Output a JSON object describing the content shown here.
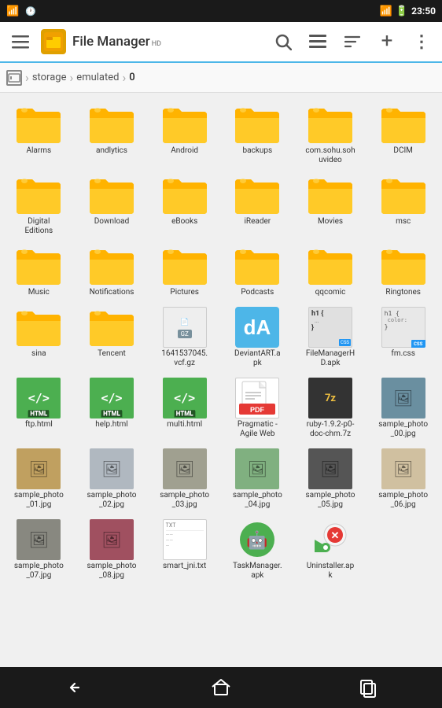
{
  "statusBar": {
    "time": "23:50",
    "batteryLevel": "80"
  },
  "toolbar": {
    "menuIcon": "☰",
    "title": "File Manager",
    "titleSup": "HD",
    "searchIcon": "search",
    "listViewIcon": "list",
    "sortIcon": "sort",
    "addIcon": "+",
    "moreIcon": "⋮"
  },
  "breadcrumb": {
    "storageLabel": "storage",
    "emulatedLabel": "emulated",
    "currentLabel": "0"
  },
  "files": [
    {
      "name": "Alarms",
      "type": "folder",
      "id": "alarms"
    },
    {
      "name": "andlytics",
      "type": "folder",
      "id": "andlytics"
    },
    {
      "name": "Android",
      "type": "folder",
      "id": "android"
    },
    {
      "name": "backups",
      "type": "folder",
      "id": "backups"
    },
    {
      "name": "com.sohu.soh\nuvideo",
      "type": "folder",
      "id": "sohu"
    },
    {
      "name": "DCIM",
      "type": "folder",
      "id": "dcim"
    },
    {
      "name": "Digital\nEditions",
      "type": "folder",
      "id": "digital"
    },
    {
      "name": "Download",
      "type": "folder",
      "id": "download"
    },
    {
      "name": "eBooks",
      "type": "folder",
      "id": "ebooks"
    },
    {
      "name": "iReader",
      "type": "folder",
      "id": "ireader"
    },
    {
      "name": "Movies",
      "type": "folder",
      "id": "movies"
    },
    {
      "name": "msc",
      "type": "folder",
      "id": "msc"
    },
    {
      "name": "Music",
      "type": "folder",
      "id": "music"
    },
    {
      "name": "Notifications",
      "type": "folder",
      "id": "notifications"
    },
    {
      "name": "Pictures",
      "type": "folder",
      "id": "pictures"
    },
    {
      "name": "Podcasts",
      "type": "folder",
      "id": "podcasts"
    },
    {
      "name": "qqcomic",
      "type": "folder",
      "id": "qqcomic"
    },
    {
      "name": "Ringtones",
      "type": "folder",
      "id": "ringtones"
    },
    {
      "name": "sina",
      "type": "folder",
      "id": "sina"
    },
    {
      "name": "Tencent",
      "type": "folder",
      "id": "tencent"
    },
    {
      "name": "1641537045.\nvcf.gz",
      "type": "gz",
      "id": "vcfgz"
    },
    {
      "name": "DeviantART.a\npk",
      "type": "apk-deviant",
      "id": "deviantart"
    },
    {
      "name": "FileManagerH\nD.apk",
      "type": "apk-fm",
      "id": "fmapk"
    },
    {
      "name": "fm.css",
      "type": "css",
      "id": "fmcss"
    },
    {
      "name": "ftp.html",
      "type": "html",
      "id": "ftphtml"
    },
    {
      "name": "help.html",
      "type": "html",
      "id": "helphtml"
    },
    {
      "name": "multi.html",
      "type": "html",
      "id": "multihtml"
    },
    {
      "name": "Pragmatic -\nAgile Web",
      "type": "pdf",
      "id": "pdf1"
    },
    {
      "name": "ruby-1.9.2-p0-\ndoc-chm.7z",
      "type": "7z",
      "id": "ruby7z"
    },
    {
      "name": "sample_photo\n_00.jpg",
      "type": "photo",
      "color": "#6a8fa0",
      "id": "photo00"
    },
    {
      "name": "sample_photo\n_01.jpg",
      "type": "photo",
      "color": "#c0a060",
      "id": "photo01"
    },
    {
      "name": "sample_photo\n_02.jpg",
      "type": "photo",
      "color": "#b0b8c0",
      "id": "photo02"
    },
    {
      "name": "sample_photo\n_03.jpg",
      "type": "photo",
      "color": "#a0a090",
      "id": "photo03"
    },
    {
      "name": "sample_photo\n_04.jpg",
      "type": "photo",
      "color": "#80b080",
      "id": "photo04"
    },
    {
      "name": "sample_photo\n_05.jpg",
      "type": "photo",
      "color": "#555555",
      "id": "photo05"
    },
    {
      "name": "sample_photo\n_06.jpg",
      "type": "photo",
      "color": "#d0c0a0",
      "id": "photo06"
    },
    {
      "name": "sample_photo\n_07.jpg",
      "type": "photo",
      "color": "#888880",
      "id": "photo07"
    },
    {
      "name": "sample_photo\n_08.jpg",
      "type": "photo",
      "color": "#a05060",
      "id": "photo08"
    },
    {
      "name": "smart_jni.txt",
      "type": "txt",
      "id": "txt1"
    },
    {
      "name": "TaskManager.\napk",
      "type": "apk-task",
      "id": "taskmanager"
    },
    {
      "name": "Uninstaller.ap\nk",
      "type": "apk-uninstall",
      "id": "uninstaller"
    }
  ],
  "bottomNav": {
    "backLabel": "back",
    "homeLabel": "home",
    "recentLabel": "recent"
  }
}
